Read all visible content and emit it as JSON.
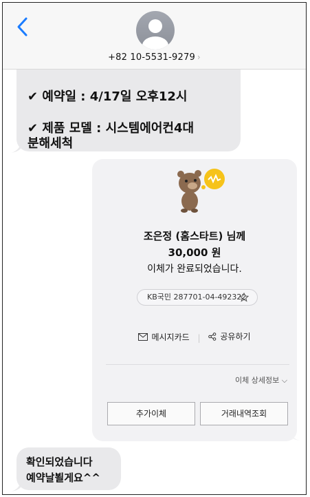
{
  "header": {
    "phone_number": "+82 10-5531-9279",
    "chevron": "›"
  },
  "messages": {
    "top_bubble": {
      "line1": "✔ 예약일 : 4/17일 오후12시",
      "line2": "✔ 제품 모델 : 시스템에어컨4대",
      "line3": "분해세척"
    },
    "transfer_card": {
      "recipient": "조은정 (홈스타트)  님께",
      "amount": "30,000 원",
      "status": "이체가 완료되었습니다.",
      "account": "KB국민  287701-04-492322",
      "message_card_label": "메시지카드",
      "share_label": "공유하기",
      "detail_label": "이체 상세정보 ⌵",
      "btn_more_transfer": "추가이체",
      "btn_history": "거래내역조회"
    },
    "bottom_bubble": {
      "line1": "확인되었습니다",
      "line2": "예약날뵐게요^^"
    }
  },
  "colors": {
    "accent_blue": "#1a7cff",
    "bubble_gray": "#e9e9eb",
    "card_gray": "#f2f2f4",
    "coin_yellow": "#f6c31a"
  },
  "icons": [
    "back-chevron-icon",
    "contact-avatar-icon",
    "bear-character-icon",
    "coin-icon",
    "star-icon",
    "mail-icon",
    "share-icon"
  ]
}
